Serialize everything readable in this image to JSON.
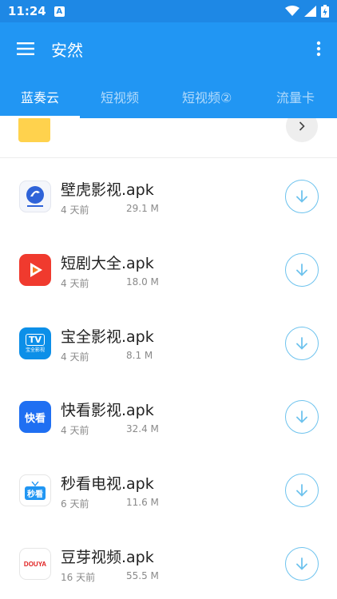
{
  "status": {
    "time": "11:24",
    "badge": "A"
  },
  "appbar": {
    "title": "安然"
  },
  "tabs": [
    {
      "label": "蓝奏云",
      "active": true
    },
    {
      "label": "短视频",
      "active": false
    },
    {
      "label": "短视频②",
      "active": false
    },
    {
      "label": "流量卡",
      "active": false
    }
  ],
  "files": [
    {
      "name": "壁虎影视.apk",
      "time": "4 天前",
      "size": "29.1 M",
      "icon": "bihu-app-icon"
    },
    {
      "name": "短剧大全.apk",
      "time": "4 天前",
      "size": "18.0 M",
      "icon": "duanju-app-icon"
    },
    {
      "name": "宝全影视.apk",
      "time": "4 天前",
      "size": "8.1 M",
      "icon": "baoquan-app-icon",
      "icon_text": "TV",
      "icon_subtext": "宝全影视"
    },
    {
      "name": "快看影视.apk",
      "time": "4 天前",
      "size": "32.4 M",
      "icon": "kuaikan-app-icon",
      "icon_text": "快看"
    },
    {
      "name": "秒看电视.apk",
      "time": "6 天前",
      "size": "11.6 M",
      "icon": "miaokan-app-icon",
      "icon_text": "秒看"
    },
    {
      "name": "豆芽视频.apk",
      "time": "16 天前",
      "size": "55.5 M",
      "icon": "douya-app-icon",
      "icon_text": "DOUYA"
    }
  ],
  "colors": {
    "primary": "#2196f3",
    "statusbar": "#1e88e5",
    "download_ring": "#6ec3ee",
    "folder": "#ffd24d"
  }
}
